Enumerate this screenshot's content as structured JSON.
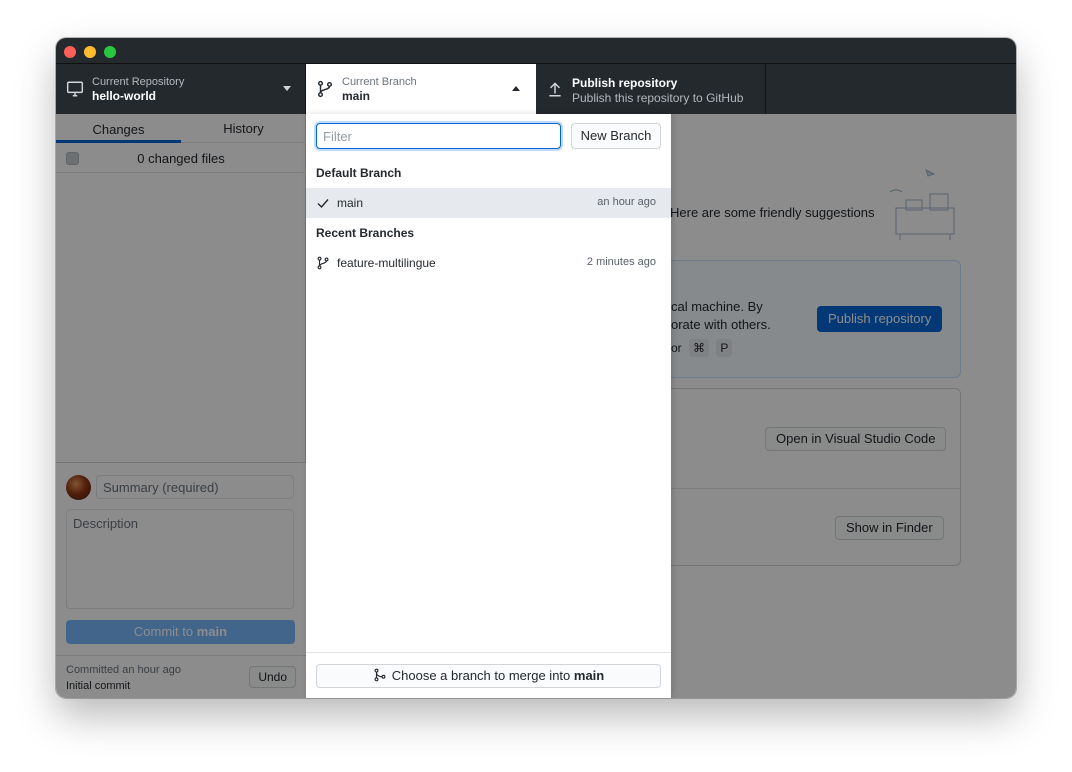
{
  "toolbar": {
    "repo_label": "Current Repository",
    "repo_name": "hello-world",
    "branch_label": "Current Branch",
    "branch_name": "main",
    "publish_title": "Publish repository",
    "publish_subtitle": "Publish this repository to GitHub"
  },
  "sidebar": {
    "tabs": [
      {
        "label": "Changes"
      },
      {
        "label": "History"
      }
    ],
    "changed_files": "0 changed files",
    "summary_placeholder": "Summary (required)",
    "description_placeholder": "Description",
    "commit_prefix": "Commit to",
    "commit_branch": "main",
    "last_commit_time": "Committed an hour ago",
    "last_commit_message": "Initial commit",
    "undo_label": "Undo"
  },
  "main": {
    "suggest_text": "Here are some friendly suggestions",
    "suggest_text_visible": "Here are some friendly suggestions",
    "publish_line1": "cal machine. By",
    "publish_line2": "orate with others.",
    "shortcut_or": "or",
    "shortcut_key1": "⌘",
    "shortcut_key2": "P",
    "publish_button": "Publish repository",
    "open_vscode_button": "Open in Visual Studio Code",
    "show_finder_button": "Show in Finder"
  },
  "dropdown": {
    "filter_placeholder": "Filter",
    "new_branch_button": "New Branch",
    "default_section": "Default Branch",
    "default_branch": {
      "name": "main",
      "time": "an hour ago"
    },
    "recent_section": "Recent Branches",
    "recent_branches": [
      {
        "name": "feature-multilingue",
        "time": "2 minutes ago"
      }
    ],
    "merge_prefix": "Choose a branch to merge into",
    "merge_branch": "main"
  },
  "colors": {
    "toolbar_bg": "#24292e",
    "accent": "#0366d6",
    "commit_button_disabled": "#79b8ff"
  }
}
